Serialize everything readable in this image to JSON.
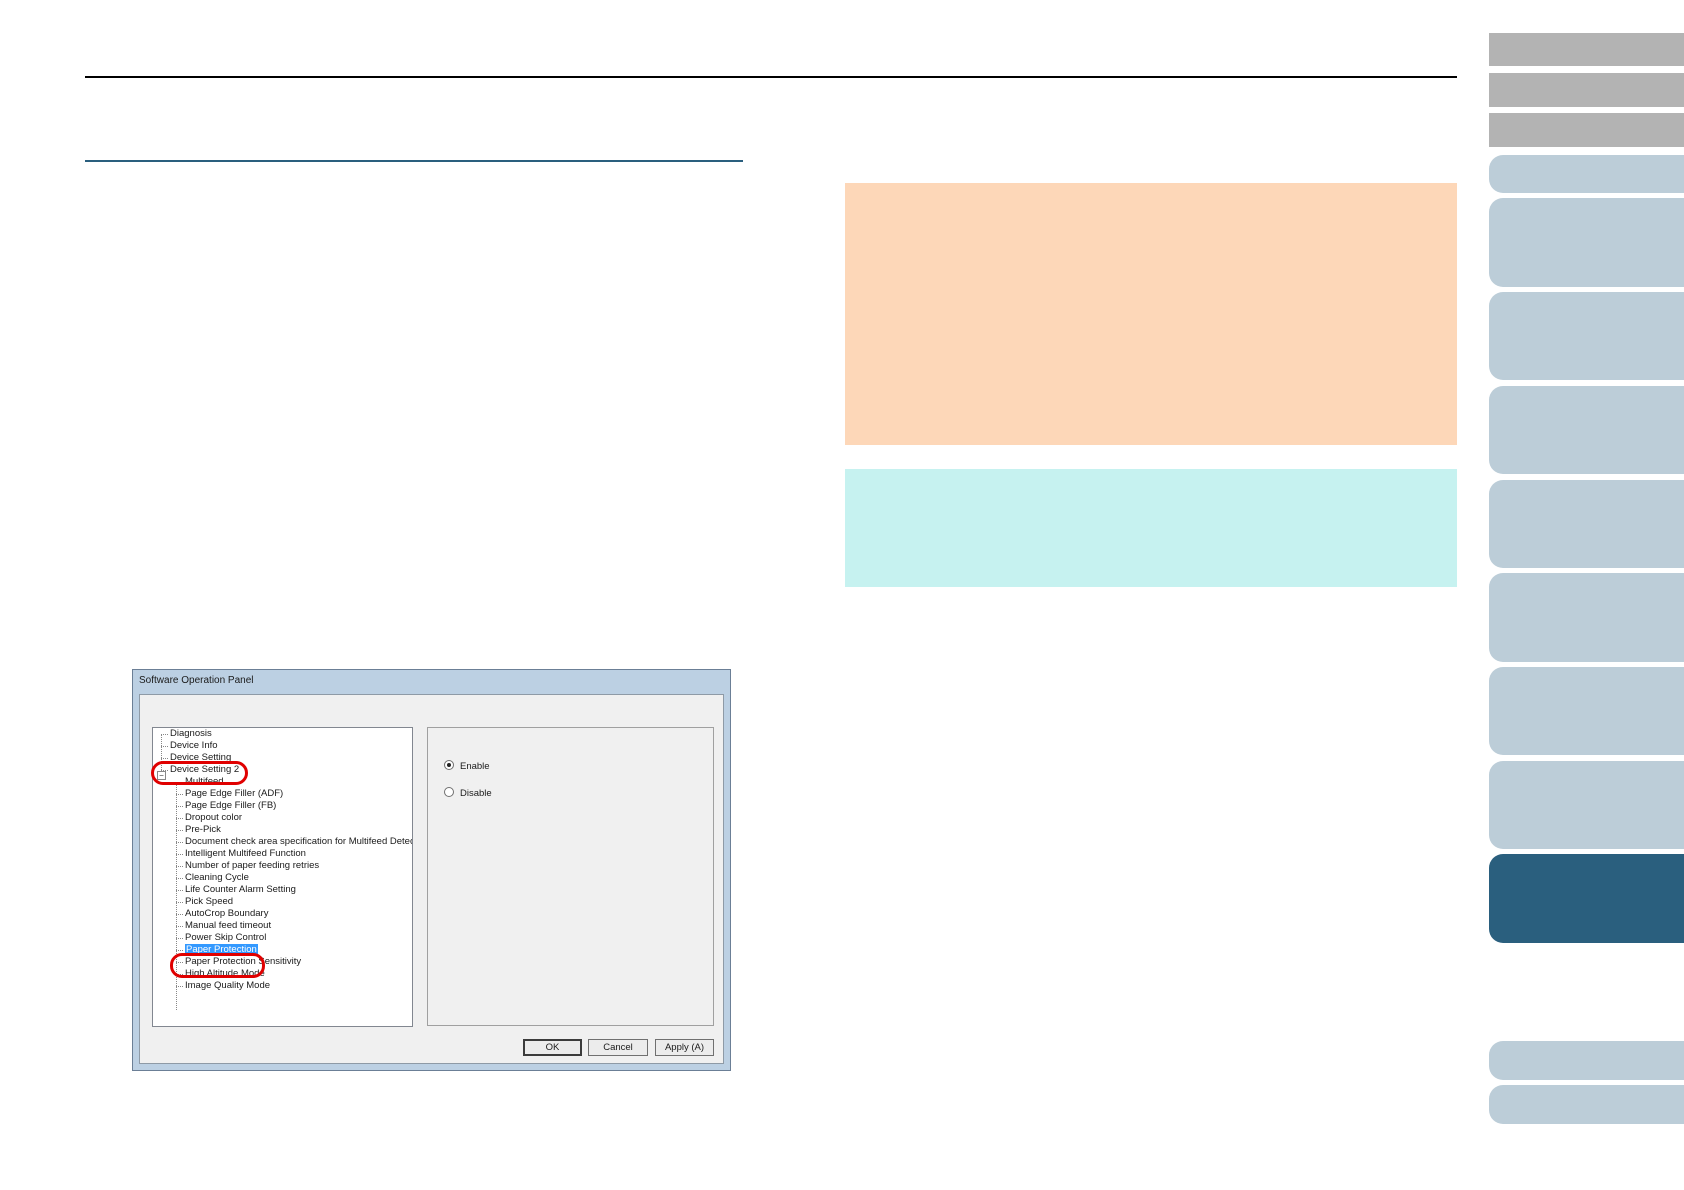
{
  "dialog": {
    "title": "Software Operation Panel",
    "tree": {
      "root_items": [
        "Diagnosis",
        "Device Info",
        "Device Setting",
        "Device Setting 2"
      ],
      "expander_glyph": "−",
      "child_items": [
        "Multifeed",
        "Page Edge Filler (ADF)",
        "Page Edge Filler (FB)",
        "Dropout color",
        "Pre-Pick",
        "Document check area specification for Multifeed Detection",
        "Intelligent Multifeed Function",
        "Number of paper feeding retries",
        "Cleaning Cycle",
        "Life Counter Alarm Setting",
        "Pick Speed",
        "AutoCrop Boundary",
        "Manual feed timeout",
        "Power Skip Control",
        "Paper Protection",
        "Paper Protection Sensitivity",
        "High Altitude Mode",
        "Image Quality Mode"
      ],
      "selected_item": "Paper Protection"
    },
    "options": {
      "enable_label": "Enable",
      "disable_label": "Disable",
      "selected": "Enable"
    },
    "buttons": {
      "ok_label": "OK",
      "cancel_label": "Cancel",
      "apply_label": "Apply (A)"
    }
  },
  "colors": {
    "attention_box": "#fdd7b8",
    "hint_box": "#c6f2f0",
    "nav_active": "#2a5f7e",
    "nav_inactive": "#bccdd8",
    "nav_grey": "#b3b3b3",
    "highlight_ring": "#e00000",
    "tree_selection": "#3399ff"
  }
}
